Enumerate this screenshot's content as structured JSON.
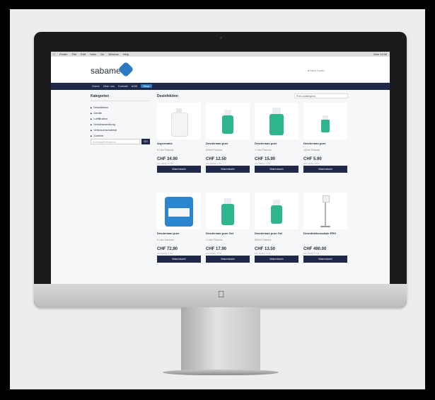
{
  "menubar": {
    "items": [
      "Finder",
      "File",
      "Edit",
      "View",
      "Go",
      "Window",
      "Help"
    ],
    "right": "Mon 11:56"
  },
  "site": {
    "logo_text": "sabamed",
    "logo_mark": "",
    "account": "Mein Konto",
    "nav": [
      "Home",
      "Über uns",
      "Kontakt",
      "AGB",
      "Shop"
    ]
  },
  "sidebar": {
    "title": "Kategorien",
    "items": [
      "Desinfektion",
      "Geräte",
      "Luftfiltration",
      "Schutzausrüstung",
      "Verbrauchsmaterial",
      "Zubehör"
    ],
    "search_placeholder": "Suchbegriff eingeben",
    "search_button": "GO"
  },
  "main": {
    "title": "Desinfektion",
    "sort": "Preis aufsteigend",
    "buy_label": "Warenkorb",
    "products": [
      {
        "name": "Aspermatic",
        "variant": "5 Liter Flasche",
        "price": "CHF 34.90",
        "vat": "inkl. MwSt. 7.7%"
      },
      {
        "name": "Desderman pure",
        "variant": "500ml Flasche",
        "price": "CHF 12.50",
        "vat": "inkl. MwSt. 7.7%"
      },
      {
        "name": "Desderman pure",
        "variant": "1 Liter Flasche",
        "price": "CHF 15.90",
        "vat": "inkl. MwSt. 7.7%"
      },
      {
        "name": "Desderman pure",
        "variant": "100ml Flasche",
        "price": "CHF 5.90",
        "vat": "inkl. MwSt. 7.7%"
      },
      {
        "name": "Desderman pure",
        "variant": "5 Liter Kanister",
        "price": "CHF 72.90",
        "vat": "inkl. MwSt. 7.7%"
      },
      {
        "name": "Desderman pure Gel",
        "variant": "1 Liter Flasche",
        "price": "CHF 17.90",
        "vat": "inkl. MwSt. 7.7%"
      },
      {
        "name": "Desderman pure Gel",
        "variant": "500ml Flasche",
        "price": "CHF 13.50",
        "vat": "inkl. MwSt. 7.7%"
      },
      {
        "name": "Desinfektionssäule PRO",
        "variant": "",
        "price": "CHF 490.00",
        "vat": "inkl. MwSt. 7.7%"
      }
    ]
  },
  "colors": {
    "navy": "#20284a",
    "accent": "#2b79c2",
    "green": "#2fb58e"
  }
}
